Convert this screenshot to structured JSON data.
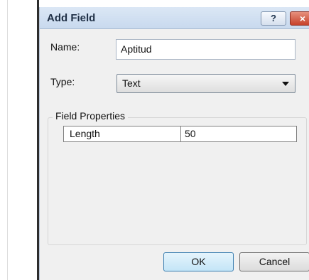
{
  "dialog": {
    "title": "Add Field",
    "help_label": "?",
    "close_label": "×"
  },
  "form": {
    "name_label": "Name:",
    "name_value": "Aptitud",
    "type_label": "Type:",
    "type_value": "Text"
  },
  "field_properties": {
    "group_title": "Field Properties",
    "rows": [
      {
        "property": "Length",
        "value": "50"
      }
    ]
  },
  "buttons": {
    "ok_label": "OK",
    "cancel_label": "Cancel"
  },
  "colors": {
    "titlebar": "#c8d9ee",
    "close_button": "#c7422b",
    "default_button": "#c4e5f7",
    "dialog_background": "#f0f0f0"
  }
}
